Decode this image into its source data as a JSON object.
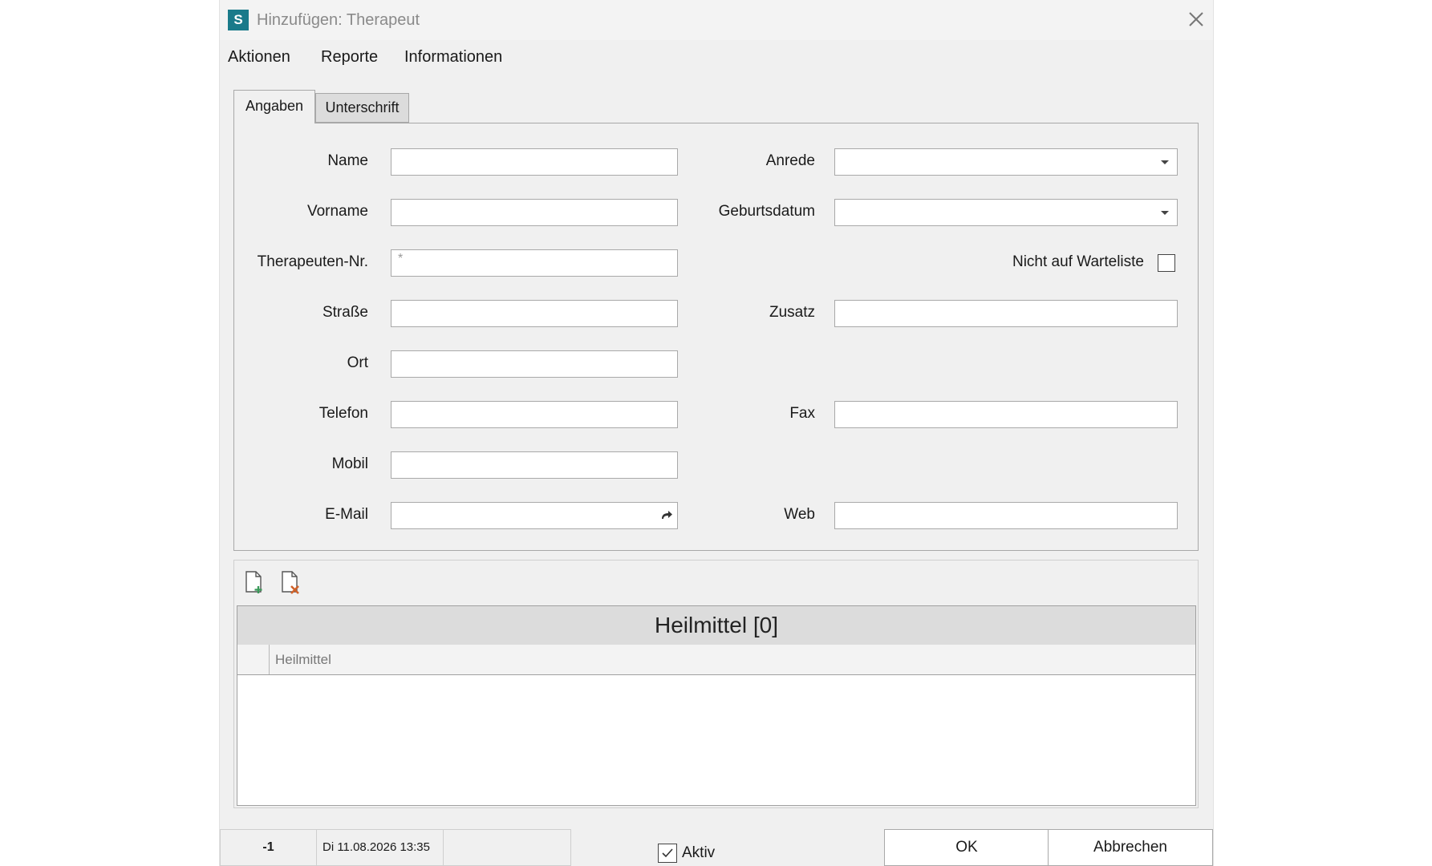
{
  "window": {
    "title": "Hinzufügen: Therapeut",
    "icon_letter": "S"
  },
  "menu": [
    "Aktionen",
    "Reporte",
    "Informationen"
  ],
  "tabs": [
    "Angaben",
    "Unterschrift"
  ],
  "form": {
    "left": [
      {
        "label": "Name",
        "value": ""
      },
      {
        "label": "Vorname",
        "value": ""
      },
      {
        "label": "Therapeuten-Nr.",
        "value": "*"
      },
      {
        "label": "Straße",
        "value": ""
      },
      {
        "label": "Ort",
        "value": ""
      },
      {
        "label": "Telefon",
        "value": ""
      },
      {
        "label": "Mobil",
        "value": ""
      },
      {
        "label": "E-Mail",
        "value": ""
      }
    ],
    "right": {
      "anrede": {
        "label": "Anrede",
        "value": ""
      },
      "geburtsdatum": {
        "label": "Geburtsdatum",
        "value": ""
      },
      "warteliste": {
        "label": "Nicht auf Warteliste",
        "checked": false
      },
      "zusatz": {
        "label": "Zusatz",
        "value": ""
      },
      "fax": {
        "label": "Fax",
        "value": ""
      },
      "web": {
        "label": "Web",
        "value": ""
      }
    }
  },
  "grid": {
    "title": "Heilmittel [0]",
    "columns": [
      "Heilmittel"
    ],
    "rows": []
  },
  "status": {
    "id": "-1",
    "datetime": "Di 11.08.2026 13:35",
    "aktiv_label": "Aktiv",
    "aktiv_checked": true
  },
  "buttons": {
    "ok": "OK",
    "cancel": "Abbrechen"
  },
  "colors": {
    "app_icon": "#1a7a8a",
    "delete_icon": "#d0622a",
    "add_icon": "#3a9a5a"
  }
}
